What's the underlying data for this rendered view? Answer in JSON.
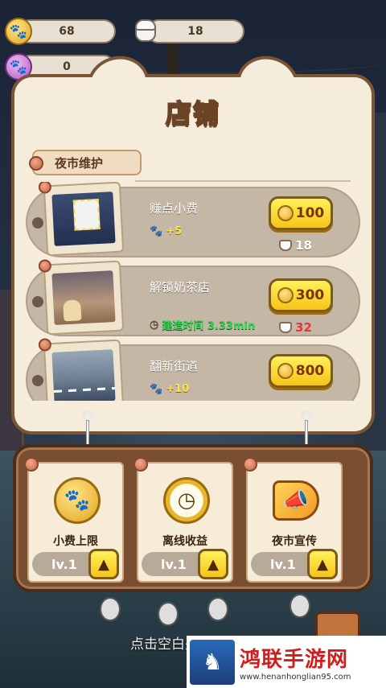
{
  "hud": {
    "gold_paw": "68",
    "cups": "18",
    "purple_paw": "0"
  },
  "shop": {
    "title": "店铺",
    "section": "夜市维护",
    "items": [
      {
        "name": "赚点小费",
        "effect": "+5",
        "price": "100",
        "extra": "18",
        "extra_color": "white"
      },
      {
        "name": "解锁奶茶店",
        "effect": "建造时间  3.33min",
        "price": "300",
        "extra": "32",
        "extra_color": "red"
      },
      {
        "name": "翻新街道",
        "effect": "+10",
        "price": "800"
      }
    ]
  },
  "upgrades": [
    {
      "label": "小费上限",
      "level": "lv.1",
      "icon": "coins-icon"
    },
    {
      "label": "离线收益",
      "level": "lv.1",
      "icon": "pocket-watch-icon"
    },
    {
      "label": "夜市宣传",
      "level": "lv.1",
      "icon": "megaphone-icon"
    }
  ],
  "hint": "点击空白关闭",
  "watermark": {
    "name": "鸿联手游网",
    "url": "www.henanhonglian95.com"
  },
  "colors": {
    "panel_bg": "#f5ecdc",
    "panel_border": "#7b5636",
    "button_yellow": "#f5c418",
    "price_text": "#7a3208",
    "effect_yellow": "#ffe14a",
    "effect_green": "#35d655",
    "extra_red": "#e8343a"
  }
}
